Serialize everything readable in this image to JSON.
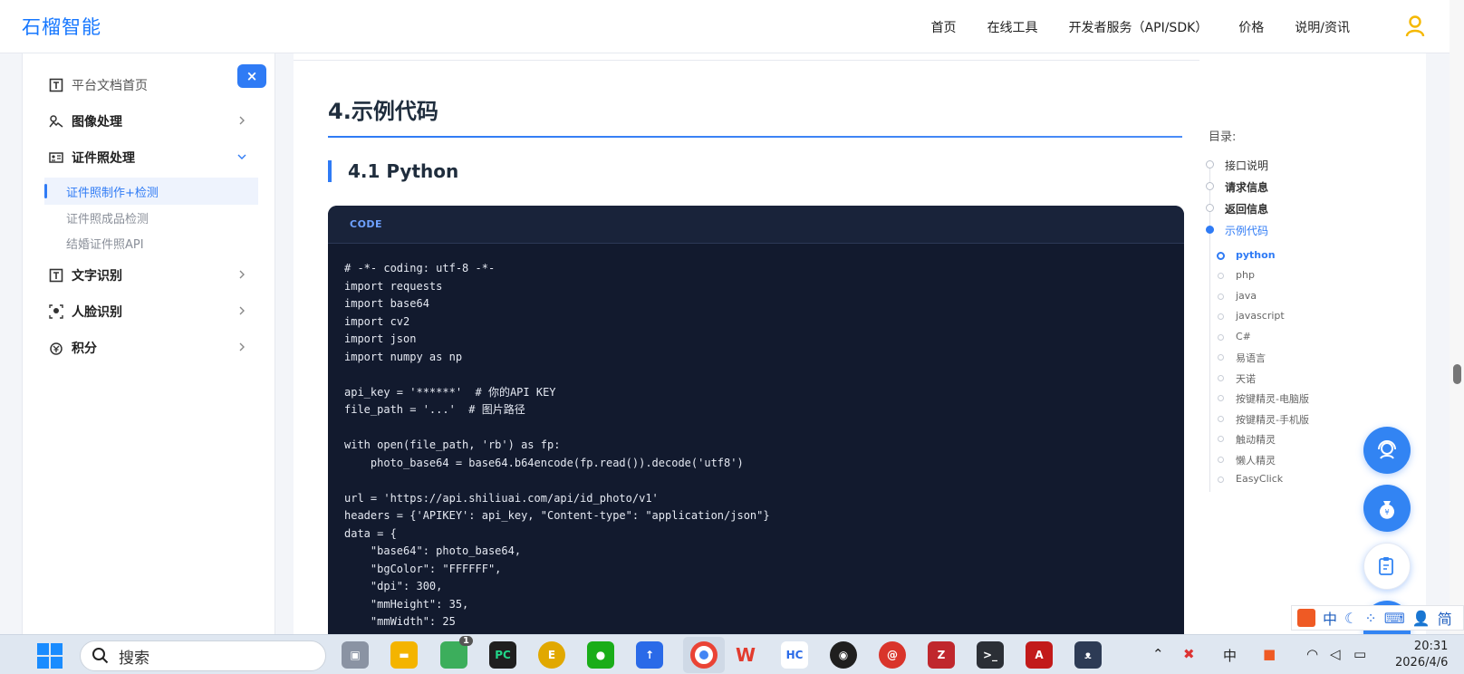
{
  "brand": "石榴智能",
  "nav": [
    "首页",
    "在线工具",
    "开发者服务（API/SDK）",
    "价格",
    "说明/资讯"
  ],
  "sidebar": {
    "items": [
      {
        "label": "平台文档首页",
        "icon": "document-icon"
      },
      {
        "label": "图像处理",
        "icon": "image-process-icon"
      },
      {
        "label": "证件照处理",
        "icon": "id-card-icon"
      },
      {
        "label": "文字识别",
        "icon": "text-icon"
      },
      {
        "label": "人脸识别",
        "icon": "face-icon"
      },
      {
        "label": "积分",
        "icon": "points-icon"
      }
    ],
    "subitems": [
      "证件照制作+检测",
      "证件照成品检测",
      "结婚证件照API"
    ],
    "close_label": "×"
  },
  "content": {
    "h2": "4.示例代码",
    "h3": "4.1 Python",
    "code_label": "CODE",
    "code": "# -*- coding: utf-8 -*-\nimport requests\nimport base64\nimport cv2\nimport json\nimport numpy as np\n\napi_key = '******'  # 你的API KEY\nfile_path = '...'  # 图片路径\n\nwith open(file_path, 'rb') as fp:\n    photo_base64 = base64.b64encode(fp.read()).decode('utf8')\n\nurl = 'https://api.shiliuai.com/api/id_photo/v1'\nheaders = {'APIKEY': api_key, \"Content-type\": \"application/json\"}\ndata = {\n    \"base64\": photo_base64,\n    \"bgColor\": \"FFFFFF\",\n    \"dpi\": 300,\n    \"mmHeight\": 35,\n    \"mmWidth\": 25"
  },
  "toc": {
    "title": "目录:",
    "items": [
      "接口说明",
      "请求信息",
      "返回信息",
      "示例代码"
    ],
    "subitems": [
      "python",
      "php",
      "java",
      "javascript",
      "C#",
      "易语言",
      "天诺",
      "按键精灵-电脑版",
      "按键精灵-手机版",
      "触动精灵",
      "懒人精灵",
      "EasyClick"
    ]
  },
  "taskbar": {
    "search": "搜索",
    "time": "20:31",
    "date": "2026/4/6",
    "ime_lang": "中",
    "badge": "1"
  },
  "ime_bar": [
    "中",
    "简"
  ],
  "colors": {
    "accent": "#2f7bf5",
    "code_bg": "#121a2e"
  }
}
